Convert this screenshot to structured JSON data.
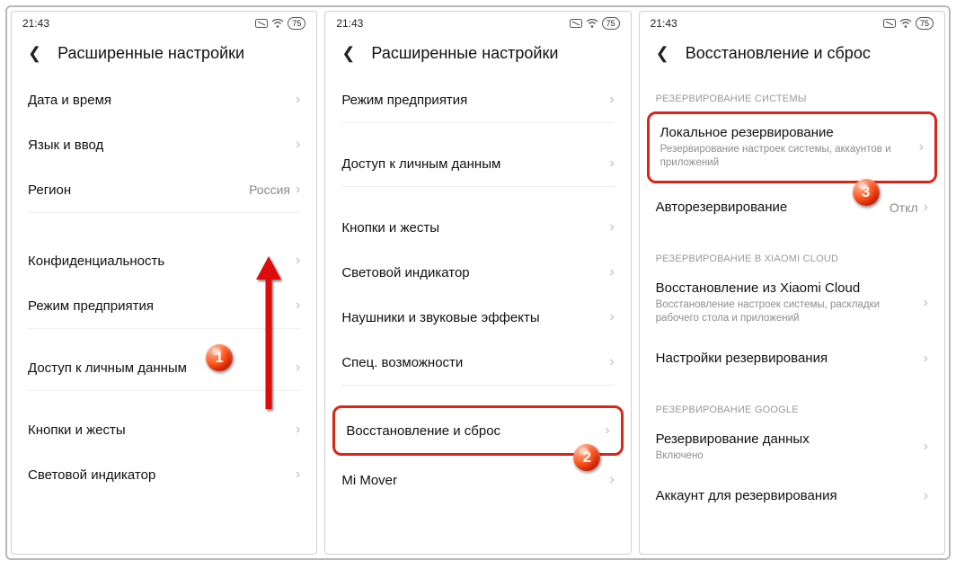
{
  "status": {
    "time": "21:43",
    "battery": "75"
  },
  "screen1": {
    "title": "Расширенные настройки",
    "items": {
      "date_time": "Дата и время",
      "lang_input": "Язык и ввод",
      "region": "Регион",
      "region_value": "Россия",
      "privacy": "Конфиденциальность",
      "enterprise": "Режим предприятия",
      "personal_data": "Доступ к личным данным",
      "buttons": "Кнопки и жесты",
      "indicator": "Световой индикатор"
    },
    "step": "1"
  },
  "screen2": {
    "title": "Расширенные настройки",
    "items": {
      "enterprise": "Режим предприятия",
      "personal_data": "Доступ к личным данным",
      "buttons": "Кнопки и жесты",
      "indicator": "Световой индикатор",
      "headphones": "Наушники и звуковые эффекты",
      "accessibility": "Спец. возможности",
      "backup_reset": "Восстановление и сброс",
      "mi_mover": "Mi Mover"
    },
    "step": "2"
  },
  "screen3": {
    "title": "Восстановление и сброс",
    "sections": {
      "system": "РЕЗЕРВИРОВАНИЕ СИСТЕМЫ",
      "cloud": "РЕЗЕРВИРОВАНИЕ В XIAOMI CLOUD",
      "google": "РЕЗЕРВИРОВАНИЕ GOOGLE"
    },
    "items": {
      "local_backup": "Локальное резервирование",
      "local_backup_sub": "Резервирование настроек системы, аккаунтов и приложений",
      "auto_backup": "Авторезервирование",
      "auto_backup_value": "Откл",
      "cloud_restore": "Восстановление из Xiaomi Cloud",
      "cloud_restore_sub": "Восстановление настроек системы, раскладки рабочего стола и приложений",
      "backup_settings": "Настройки резервирования",
      "google_backup": "Резервирование данных",
      "google_backup_sub": "Включено",
      "account": "Аккаунт для резервирования"
    },
    "step": "3"
  }
}
